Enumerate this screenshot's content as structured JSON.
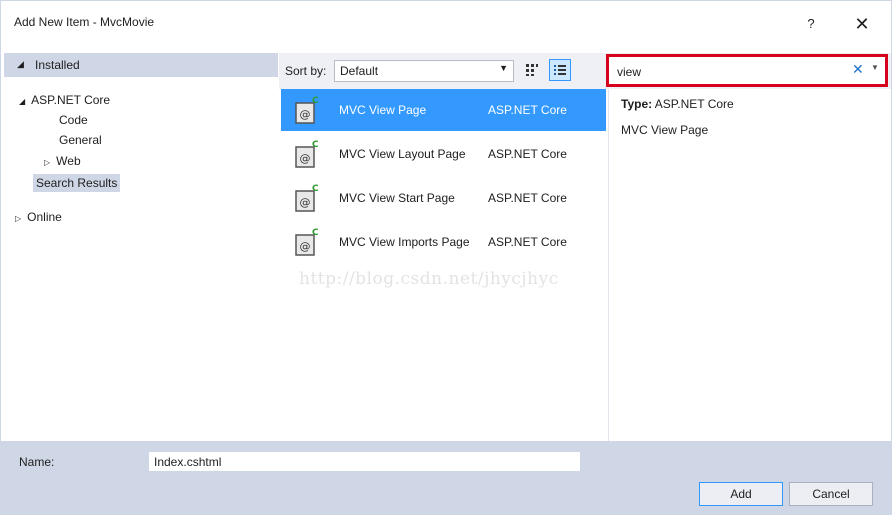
{
  "window": {
    "title": "Add New Item - MvcMovie",
    "help_label": "?",
    "close_label": "✕"
  },
  "left": {
    "header": "Installed",
    "tree": [
      {
        "label": "ASP.NET Core",
        "expanded": true
      },
      {
        "label": "Code"
      },
      {
        "label": "General"
      },
      {
        "label": "Web",
        "collapsed": true
      },
      {
        "label": "Search Results",
        "selected": true
      },
      {
        "label": "Online",
        "collapsed": true
      }
    ]
  },
  "toolbar": {
    "sort_label": "Sort by:",
    "sort_value": "Default"
  },
  "search": {
    "value": "view"
  },
  "templates": [
    {
      "name": "MVC View Page",
      "lang": "ASP.NET Core",
      "selected": true
    },
    {
      "name": "MVC View Layout Page",
      "lang": "ASP.NET Core"
    },
    {
      "name": "MVC View Start Page",
      "lang": "ASP.NET Core"
    },
    {
      "name": "MVC View Imports Page",
      "lang": "ASP.NET Core"
    }
  ],
  "watermark": "http://blog.csdn.net/jhycjhyc",
  "details": {
    "type_label": "Type:",
    "type_value": "ASP.NET Core",
    "name": "MVC View Page"
  },
  "bottom": {
    "name_label": "Name:",
    "name_value": "Index.cshtml",
    "add_label": "Add",
    "cancel_label": "Cancel"
  },
  "colors": {
    "selection": "#3399ff",
    "panel": "#cfd6e5",
    "highlight_border": "#d6001c"
  }
}
